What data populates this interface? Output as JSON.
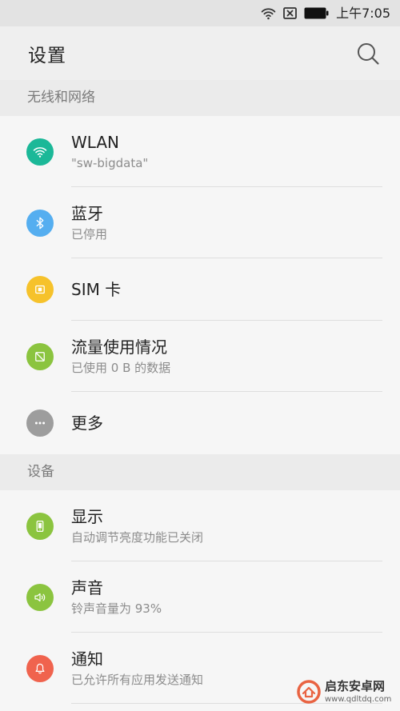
{
  "status_bar": {
    "time": "上午7:05",
    "icons": [
      "wifi-icon",
      "no-sim-icon",
      "battery-icon"
    ]
  },
  "header": {
    "title": "设置",
    "search_icon": "search-icon"
  },
  "sections": [
    {
      "title": "无线和网络",
      "items": [
        {
          "title": "WLAN",
          "subtitle": "\"sw-bigdata\"",
          "icon": "wifi-icon",
          "color": "#1bb898"
        },
        {
          "title": "蓝牙",
          "subtitle": "已停用",
          "icon": "bluetooth-icon",
          "color": "#55aef0"
        },
        {
          "title": "SIM 卡",
          "icon": "sim-card-icon",
          "color": "#f6c22b"
        },
        {
          "title": "流量使用情况",
          "subtitle": "已使用 0 B 的数据",
          "icon": "data-usage-icon",
          "color": "#8bc43f"
        },
        {
          "title": "更多",
          "icon": "more-icon",
          "color": "#9d9d9d"
        }
      ]
    },
    {
      "title": "设备",
      "items": [
        {
          "title": "显示",
          "subtitle": "自动调节亮度功能已关闭",
          "icon": "display-icon",
          "color": "#8bc43f"
        },
        {
          "title": "声音",
          "subtitle": "铃声音量为 93%",
          "icon": "sound-icon",
          "color": "#8bc43f"
        },
        {
          "title": "通知",
          "subtitle": "已允许所有应用发送通知",
          "icon": "bell-icon",
          "color": "#f0634e"
        }
      ]
    }
  ],
  "watermark": {
    "name": "启东安卓网",
    "url": "www.qdltdq.com",
    "color": "#e8542f"
  }
}
